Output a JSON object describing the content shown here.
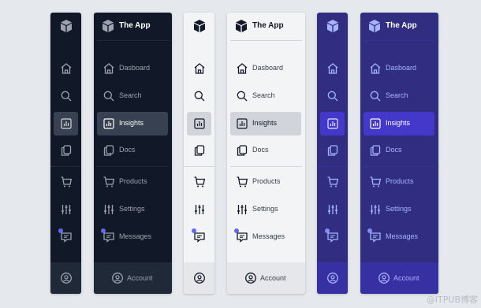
{
  "app": {
    "title": "The App"
  },
  "nav": {
    "dashboard": "Dasboard",
    "search": "Search",
    "insights": "Insights",
    "docs": "Docs",
    "products": "Products",
    "settings": "Settings",
    "messages": "Messages",
    "account": "Account"
  },
  "active_item": "insights",
  "watermark": "@ITPUB博客",
  "themes": {
    "dark": {
      "bg": "#111827",
      "footer": "#1f2937",
      "active": "#374151",
      "text": "#9ca3af",
      "active_text": "#ffffff",
      "title": "#ffffff",
      "divider": "#1f2937",
      "icon": "#9ca3af"
    },
    "light": {
      "bg": "#f3f4f6",
      "footer": "#e5e7eb",
      "active": "#d1d5db",
      "text": "#374151",
      "active_text": "#111827",
      "title": "#111827",
      "divider": "#d1d5db",
      "icon": "#111827"
    },
    "indigo": {
      "bg": "#312e81",
      "footer": "#3730a3",
      "active": "#4338ca",
      "text": "#a5b4fc",
      "active_text": "#ffffff",
      "title": "#ffffff",
      "divider": "#3730a3",
      "icon": "#a5b4fc"
    }
  }
}
